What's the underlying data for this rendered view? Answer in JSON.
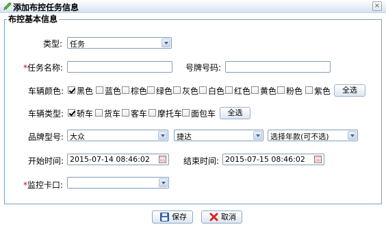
{
  "window": {
    "title": "添加布控任务信息",
    "close_glyph": "×"
  },
  "section": {
    "legend": "布控基本信息"
  },
  "type_field": {
    "label": "类型:",
    "value": "任务"
  },
  "task_name": {
    "label": "任务名称:",
    "required_mark": "*",
    "value": ""
  },
  "plate": {
    "label": "号牌号码:",
    "value": ""
  },
  "colors": {
    "label": "车辆颜色:",
    "options": [
      {
        "label": "黑色",
        "checked": true
      },
      {
        "label": "蓝色",
        "checked": false
      },
      {
        "label": "棕色",
        "checked": false
      },
      {
        "label": "绿色",
        "checked": false
      },
      {
        "label": "灰色",
        "checked": false
      },
      {
        "label": "白色",
        "checked": false
      },
      {
        "label": "红色",
        "checked": false
      },
      {
        "label": "黄色",
        "checked": false
      },
      {
        "label": "粉色",
        "checked": false
      },
      {
        "label": "紫色",
        "checked": false
      }
    ],
    "select_all": "全选"
  },
  "vehicle_types": {
    "label": "车辆类型:",
    "options": [
      {
        "label": "轿车",
        "checked": true
      },
      {
        "label": "货车",
        "checked": false
      },
      {
        "label": "客车",
        "checked": false
      },
      {
        "label": "摩托车",
        "checked": false
      },
      {
        "label": "面包车",
        "checked": false
      }
    ],
    "select_all": "全选"
  },
  "brand": {
    "label": "品牌型号:",
    "brand_value": "大众",
    "model_value": "捷达",
    "year_value": "选择年款(可不选)"
  },
  "start_time": {
    "label": "开始时间:",
    "value": "2015-07-14 08:46:02"
  },
  "end_time": {
    "label": "结束时间:",
    "value": "2015-07-15 08:46:02"
  },
  "checkpoint": {
    "label": "监控卡口:",
    "required_mark": "*",
    "value": ""
  },
  "footer": {
    "save_label": "保存",
    "cancel_label": "取消"
  }
}
